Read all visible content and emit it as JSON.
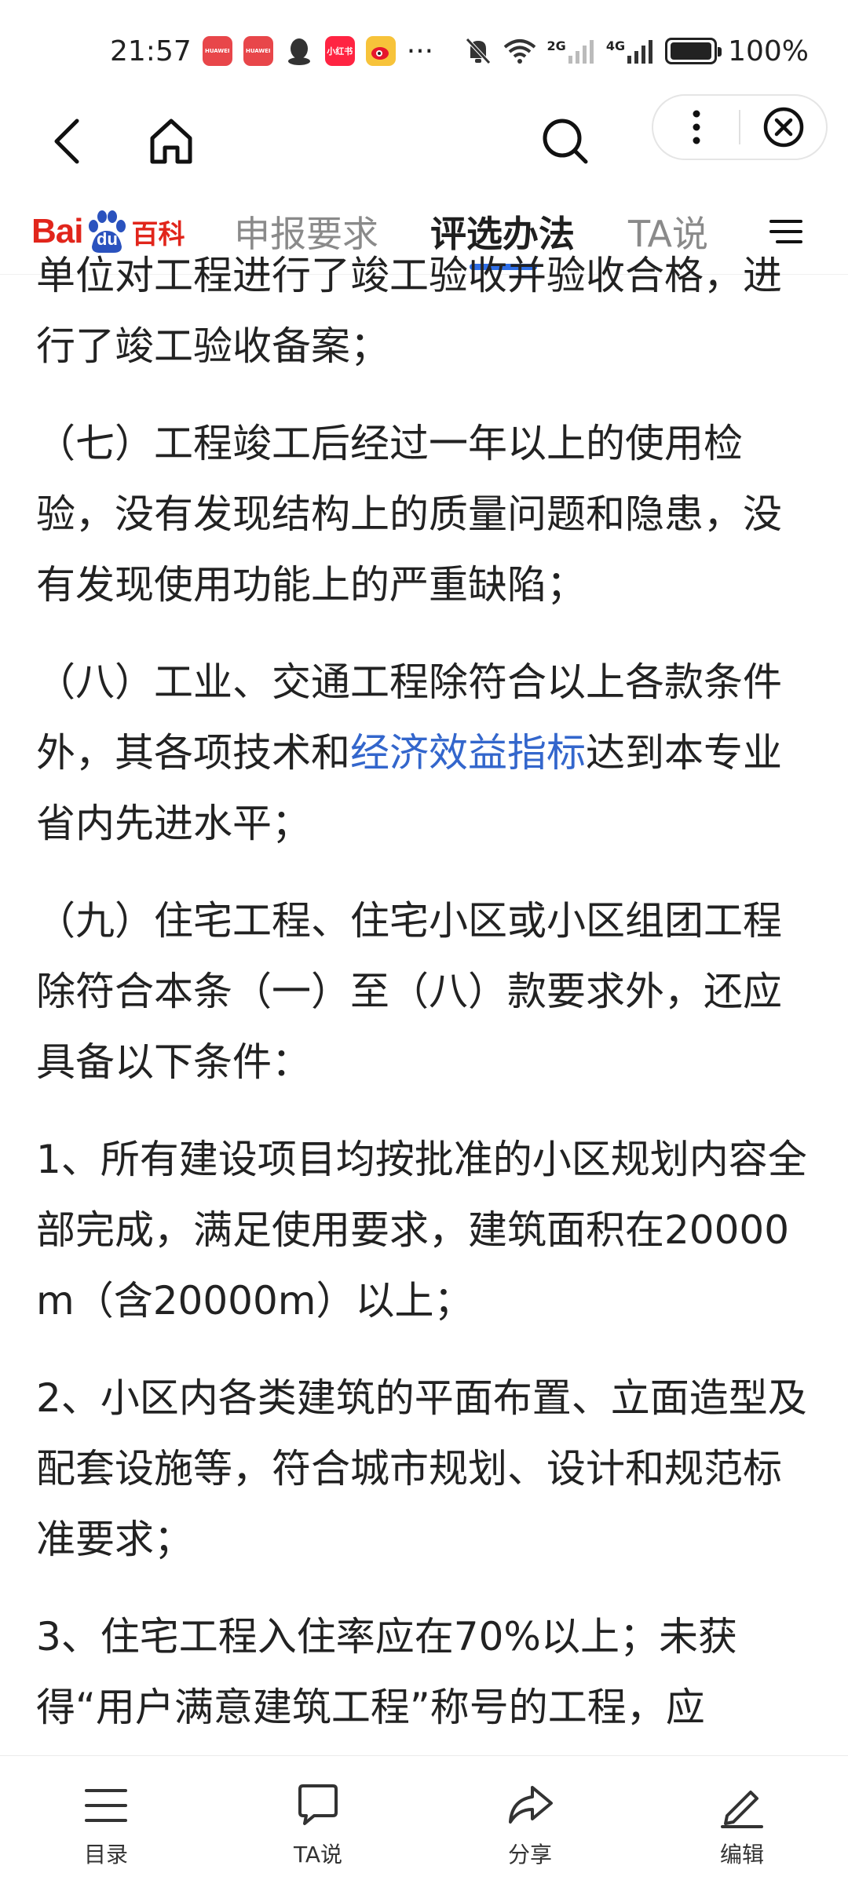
{
  "status_bar": {
    "time": "21:57",
    "apps": [
      "HUAWEI",
      "HUAWEI",
      "小红书"
    ],
    "more": "···",
    "network_2g": "2G",
    "network_4g": "4G",
    "battery": "100%"
  },
  "brand": {
    "logo_bai": "Bai",
    "logo_du": "du",
    "logo_wiki": "百科"
  },
  "tabs": [
    {
      "label": "申报要求",
      "active": false
    },
    {
      "label": "评选办法",
      "active": true
    },
    {
      "label": "TA说",
      "active": false
    }
  ],
  "article": {
    "p0": "单位对工程进行了竣工验收并验收合格，进行了竣工验收备案；",
    "p1": "（七）工程竣工后经过一年以上的使用检验，没有发现结构上的质量问题和隐患，没有发现使用功能上的严重缺陷；",
    "p2_before": "（八）工业、交通工程除符合以上各款条件外，其各项技术和",
    "p2_link": "经济效益指标",
    "p2_after": "达到本专业省内先进水平；",
    "p3": "（九）住宅工程、住宅小区或小区组团工程除符合本条（一）至（八）款要求外，还应具备以下条件：",
    "p4": "1、所有建设项目均按批准的小区规划内容全部完成，满足使用要求，建筑面积在20000m（含20000m）以上；",
    "p5": "2、小区内各类建筑的平面布置、立面造型及配套设施等，符合城市规划、设计和规范标准要求；",
    "p6": "3、住宅工程入住率应在70%以上；未获得“用户满意建筑工程”称号的工程，应"
  },
  "bottom_bar": [
    {
      "label": "目录",
      "icon": "list-icon"
    },
    {
      "label": "TA说",
      "icon": "chat-icon"
    },
    {
      "label": "分享",
      "icon": "share-icon"
    },
    {
      "label": "编辑",
      "icon": "edit-icon"
    }
  ],
  "colors": {
    "accent": "#2f6ee6",
    "link": "#3366cc",
    "brand_red": "#e1251b",
    "brand_blue": "#2a52be"
  }
}
